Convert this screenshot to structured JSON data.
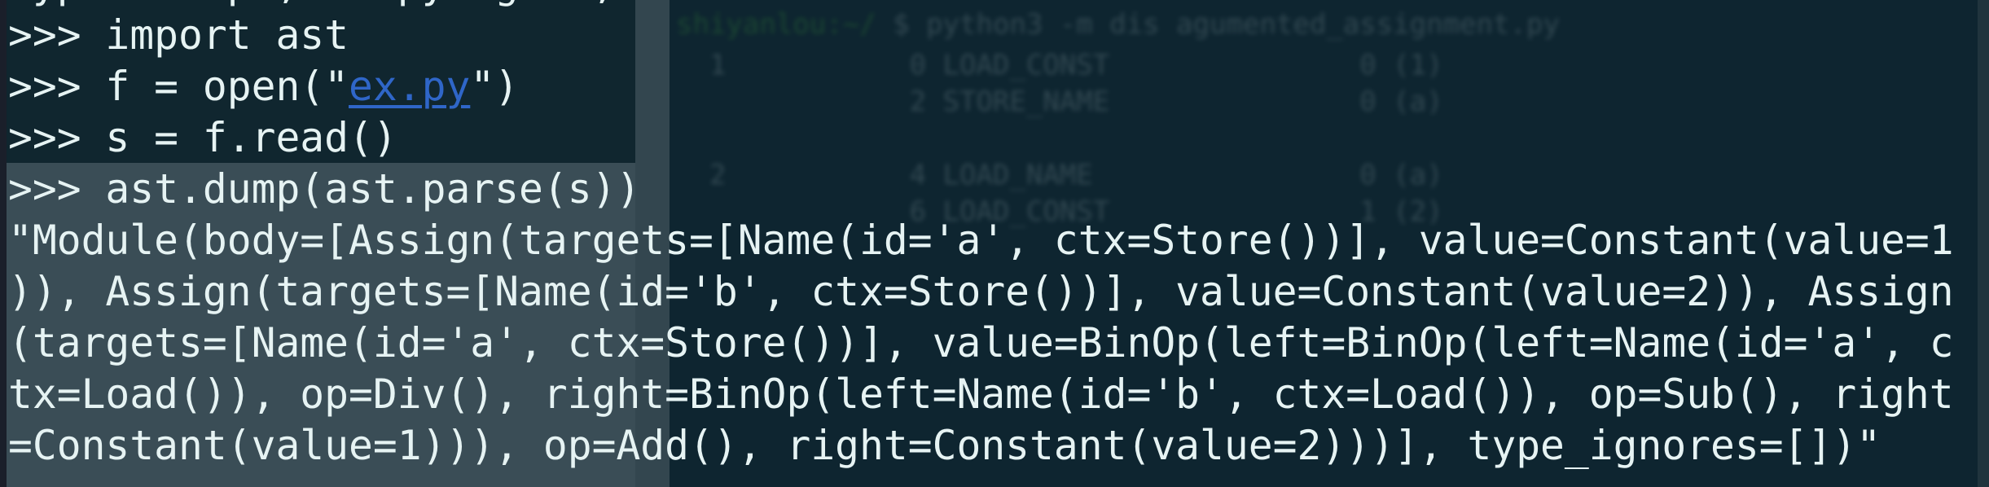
{
  "background": {
    "prompt_user": "shiyanlou:~/",
    "prompt_cmd": "$ python3 -m dis agumented_assignment.py",
    "dis_rows": [
      "  1           0 LOAD_CONST               0 (1)",
      "              2 STORE_NAME               0 (a)",
      "",
      "  2           4 LOAD_NAME                0 (a)",
      "              6 LOAD_CONST               1 (2)"
    ]
  },
  "terminal": {
    "lines": [
      "Type \"help\", \"copyright\", \"credits\" or \"license\" for more information.",
      ">>> import ast"
    ],
    "open_prefix": ">>> f = open(\"",
    "open_link": "ex.py",
    "open_suffix": "\")",
    "lines2": [
      ">>> s = f.read()",
      ">>> ast.dump(ast.parse(s))",
      "\"Module(body=[Assign(targets=[Name(id='a', ctx=Store())], value=Constant(value=1",
      ")), Assign(targets=[Name(id='b', ctx=Store())], value=Constant(value=2)), Assign",
      "(targets=[Name(id='a', ctx=Store())], value=BinOp(left=BinOp(left=Name(id='a', c",
      "tx=Load()), op=Div(), right=BinOp(left=Name(id='b', ctx=Load()), op=Sub(), right",
      "=Constant(value=1))), op=Add(), right=Constant(value=2)))], type_ignores=[])\""
    ]
  },
  "colors": {
    "text": "#e6f3f3",
    "link": "#2f66c8",
    "background": "#0e2530"
  }
}
